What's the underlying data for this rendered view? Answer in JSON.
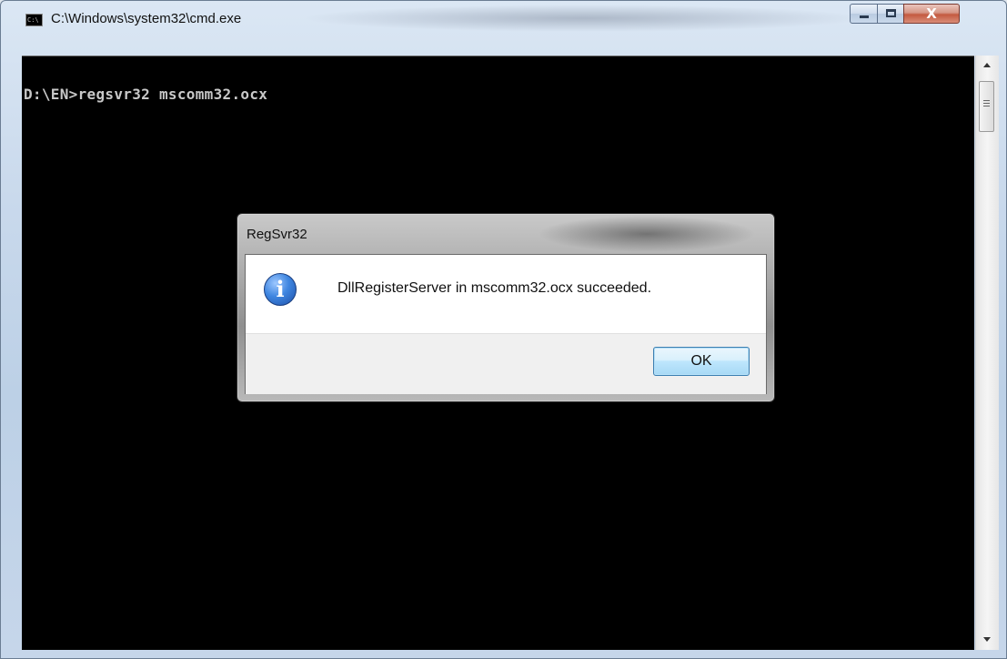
{
  "window": {
    "title": "C:\\Windows\\system32\\cmd.exe",
    "icon_text": "C:\\",
    "close_glyph": "X"
  },
  "console": {
    "lines": [
      "D:\\EN>regsvr32 mscomm32.ocx"
    ]
  },
  "dialog": {
    "title": "RegSvr32",
    "message": "DllRegisterServer in mscomm32.ocx succeeded.",
    "icon_glyph": "i",
    "ok_label": "OK"
  },
  "colors": {
    "console_bg": "#000000",
    "console_text": "#c8c8c8",
    "ok_button_border": "#3c7fb1",
    "info_icon": "#3f86e0"
  },
  "icons": [
    "cmd-app-icon",
    "minimize-icon",
    "maximize-icon",
    "close-icon",
    "info-icon",
    "scroll-up-icon",
    "scroll-down-icon"
  ]
}
